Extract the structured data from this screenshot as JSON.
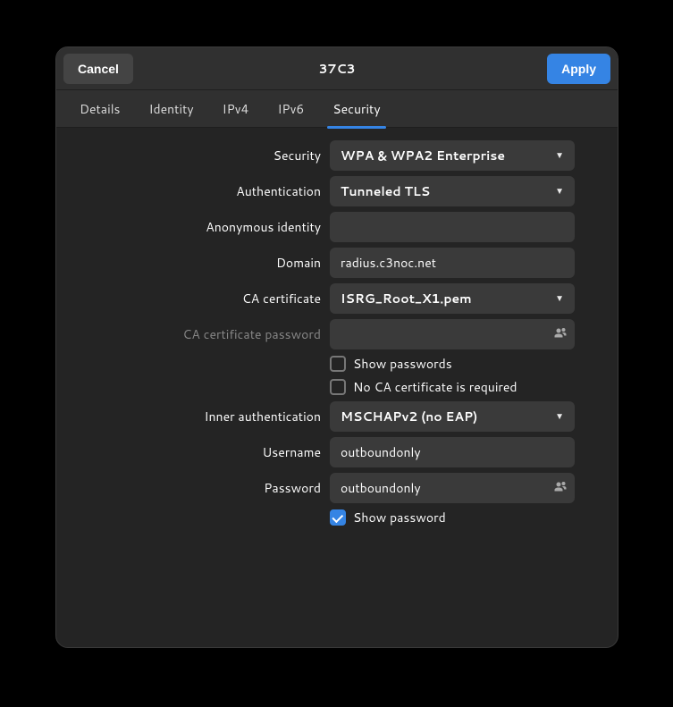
{
  "header": {
    "cancel": "Cancel",
    "title": "37C3",
    "apply": "Apply"
  },
  "tabs": {
    "details": "Details",
    "identity": "Identity",
    "ipv4": "IPv4",
    "ipv6": "IPv6",
    "security": "Security"
  },
  "labels": {
    "security": "Security",
    "authentication": "Authentication",
    "anon_identity": "Anonymous identity",
    "domain": "Domain",
    "ca_cert": "CA certificate",
    "ca_cert_pw": "CA certificate password",
    "show_passwords": "Show passwords",
    "no_ca_required": "No CA certificate is required",
    "inner_auth": "Inner authentication",
    "username": "Username",
    "password": "Password",
    "show_password": "Show password"
  },
  "values": {
    "security": "WPA & WPA2 Enterprise",
    "authentication": "Tunneled TLS",
    "anon_identity": "",
    "domain": "radius.c3noc.net",
    "ca_cert": "ISRG_Root_X1.pem",
    "ca_cert_pw": "",
    "inner_auth": "MSCHAPv2 (no EAP)",
    "username": "outboundonly",
    "password": "outboundonly"
  }
}
